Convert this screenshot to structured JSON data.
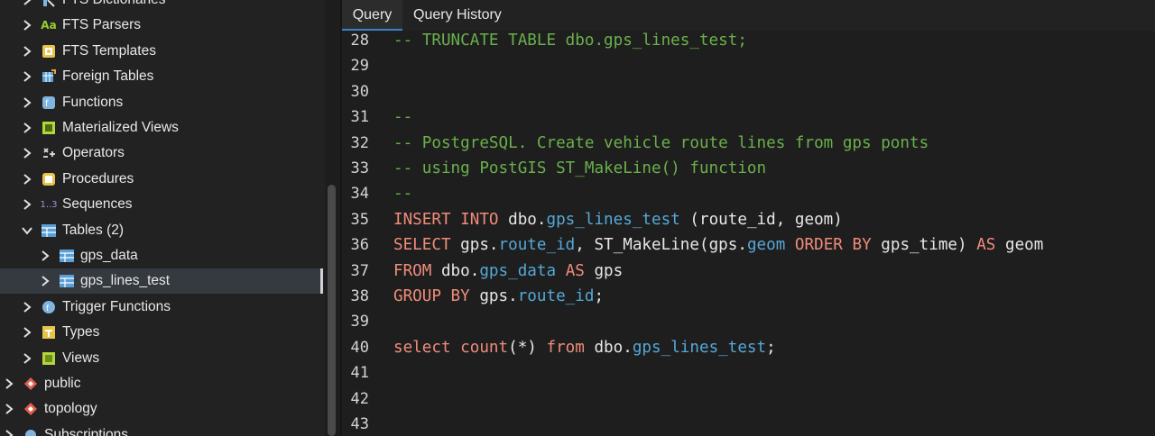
{
  "sidebar": {
    "items": [
      {
        "label": "FTS Dictionaries",
        "icon": "fts-dictionary-icon",
        "expander": "chevron-right"
      },
      {
        "label": "FTS Parsers",
        "icon": "fts-parser-icon",
        "expander": "chevron-right"
      },
      {
        "label": "FTS Templates",
        "icon": "fts-template-icon",
        "expander": "chevron-right"
      },
      {
        "label": "Foreign Tables",
        "icon": "foreign-table-icon",
        "expander": "chevron-right"
      },
      {
        "label": "Functions",
        "icon": "function-icon",
        "expander": "chevron-right"
      },
      {
        "label": "Materialized Views",
        "icon": "materialized-view-icon",
        "expander": "chevron-right"
      },
      {
        "label": "Operators",
        "icon": "operator-icon",
        "expander": "chevron-right"
      },
      {
        "label": "Procedures",
        "icon": "procedure-icon",
        "expander": "chevron-right"
      },
      {
        "label": "Sequences",
        "icon": "sequence-icon",
        "icon_text": "1..3",
        "expander": "chevron-right"
      },
      {
        "label": "Tables (2)",
        "icon": "table-icon",
        "expander": "chevron-down"
      },
      {
        "label": "gps_data",
        "icon": "table-icon",
        "expander": "chevron-right"
      },
      {
        "label": "gps_lines_test",
        "icon": "table-icon",
        "expander": "chevron-right",
        "selected": true
      },
      {
        "label": "Trigger Functions",
        "icon": "trigger-function-icon",
        "expander": "chevron-right"
      },
      {
        "label": "Types",
        "icon": "type-icon",
        "expander": "chevron-right"
      },
      {
        "label": "Views",
        "icon": "view-icon",
        "expander": "chevron-right"
      },
      {
        "label": "public",
        "icon": "schema-icon",
        "expander": "chevron-right"
      },
      {
        "label": "topology",
        "icon": "schema-icon",
        "expander": "chevron-right"
      },
      {
        "label": "Subscriptions",
        "icon": "subscription-icon",
        "expander": "chevron-right"
      }
    ]
  },
  "editor": {
    "tabs": [
      {
        "label": "Query",
        "active": true
      },
      {
        "label": "Query History",
        "active": false
      }
    ],
    "lines": [
      {
        "n": "28",
        "tokens": [
          {
            "t": "-- TRUNCATE TABLE dbo.gps_lines_test;",
            "c": "cm"
          }
        ]
      },
      {
        "n": "29",
        "tokens": []
      },
      {
        "n": "30",
        "tokens": []
      },
      {
        "n": "31",
        "tokens": [
          {
            "t": "--",
            "c": "cm"
          }
        ]
      },
      {
        "n": "32",
        "tokens": [
          {
            "t": "-- PostgreSQL. Create vehicle route lines from gps ponts",
            "c": "cm"
          }
        ]
      },
      {
        "n": "33",
        "tokens": [
          {
            "t": "-- using PostGIS ST_MakeLine() function",
            "c": "cm"
          }
        ]
      },
      {
        "n": "34",
        "tokens": [
          {
            "t": "--",
            "c": "cm"
          }
        ]
      },
      {
        "n": "35",
        "tokens": [
          {
            "t": "INSERT INTO",
            "c": "kw"
          },
          {
            "t": " dbo.",
            "c": "pl"
          },
          {
            "t": "gps_lines_test",
            "c": "fld"
          },
          {
            "t": " (route_id, geom)",
            "c": "pl"
          }
        ]
      },
      {
        "n": "36",
        "tokens": [
          {
            "t": "SELECT",
            "c": "kw"
          },
          {
            "t": " gps.",
            "c": "pl"
          },
          {
            "t": "route_id",
            "c": "fld"
          },
          {
            "t": ", ST_MakeLine(gps.",
            "c": "pl"
          },
          {
            "t": "geom",
            "c": "fld"
          },
          {
            "t": " ",
            "c": "pl"
          },
          {
            "t": "ORDER BY",
            "c": "kw"
          },
          {
            "t": " gps_time) ",
            "c": "pl"
          },
          {
            "t": "AS",
            "c": "kw"
          },
          {
            "t": " geom",
            "c": "pl"
          }
        ]
      },
      {
        "n": "37",
        "tokens": [
          {
            "t": "FROM",
            "c": "kw"
          },
          {
            "t": " dbo.",
            "c": "pl"
          },
          {
            "t": "gps_data",
            "c": "fld"
          },
          {
            "t": " ",
            "c": "pl"
          },
          {
            "t": "AS",
            "c": "kw"
          },
          {
            "t": " gps",
            "c": "pl"
          }
        ]
      },
      {
        "n": "38",
        "tokens": [
          {
            "t": "GROUP BY",
            "c": "kw"
          },
          {
            "t": " gps.",
            "c": "pl"
          },
          {
            "t": "route_id",
            "c": "fld"
          },
          {
            "t": ";",
            "c": "pl"
          }
        ]
      },
      {
        "n": "39",
        "tokens": []
      },
      {
        "n": "40",
        "tokens": [
          {
            "t": "select count",
            "c": "kw"
          },
          {
            "t": "(*) ",
            "c": "pl"
          },
          {
            "t": "from",
            "c": "kw"
          },
          {
            "t": " dbo.",
            "c": "pl"
          },
          {
            "t": "gps_lines_test",
            "c": "fld"
          },
          {
            "t": ";",
            "c": "pl"
          }
        ]
      },
      {
        "n": "41",
        "tokens": []
      },
      {
        "n": "42",
        "tokens": []
      },
      {
        "n": "43",
        "tokens": []
      }
    ]
  },
  "colors": {
    "comment": "#6ab04c",
    "keyword": "#f08c7a",
    "field": "#55a8d8",
    "text": "#e6e6e6",
    "active_tab_underline": "#3b82c4"
  }
}
